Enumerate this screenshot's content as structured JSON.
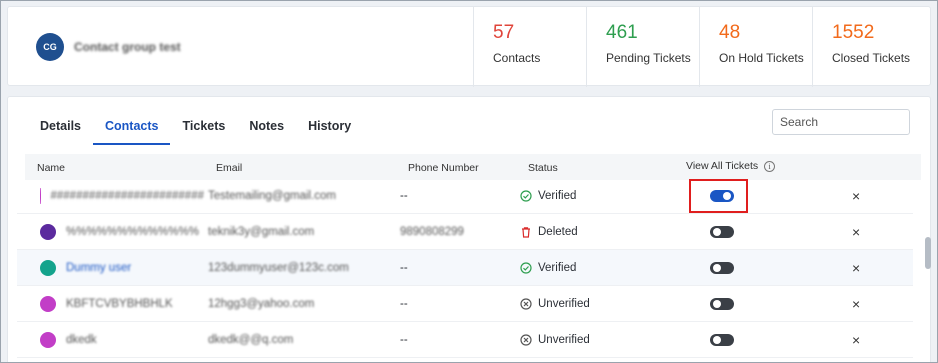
{
  "group": {
    "initials": "CG",
    "name": "Contact group test"
  },
  "stats": [
    {
      "value": "57",
      "label": "Contacts",
      "color": "#e0443a"
    },
    {
      "value": "461",
      "label": "Pending Tickets",
      "color": "#2e9e4f"
    },
    {
      "value": "48",
      "label": "On Hold Tickets",
      "color": "#f26a1b"
    },
    {
      "value": "1552",
      "label": "Closed Tickets",
      "color": "#f26a1b"
    }
  ],
  "tabs": [
    "Details",
    "Contacts",
    "Tickets",
    "Notes",
    "History"
  ],
  "active_tab": "Contacts",
  "search": {
    "placeholder": "Search"
  },
  "table": {
    "headers": {
      "name": "Name",
      "email": "Email",
      "phone": "Phone Number",
      "status": "Status",
      "view_all": "View All Tickets"
    },
    "rows": [
      {
        "name": "########################",
        "email": "Testemailing@gmail.com",
        "phone": "--",
        "status": "Verified",
        "view_all_on": true,
        "avatar_color": "#c23ec7"
      },
      {
        "name": "%%%%%%%%%%%%%",
        "email": "teknik3y@gmail.com",
        "phone": "9890808299",
        "status": "Deleted",
        "view_all_on": false,
        "avatar_color": "#5b2a9e"
      },
      {
        "name": "Dummy user",
        "email": "123dummyuser@123c.com",
        "phone": "--",
        "status": "Verified",
        "view_all_on": false,
        "avatar_color": "#14a38c"
      },
      {
        "name": "KBFTCVBYBHBHLK",
        "email": "12hgg3@yahoo.com",
        "phone": "--",
        "status": "Unverified",
        "view_all_on": false,
        "avatar_color": "#c23ec7"
      },
      {
        "name": "dkedk",
        "email": "dkedk@@q.com",
        "phone": "--",
        "status": "Unverified",
        "view_all_on": false,
        "avatar_color": "#c23ec7"
      }
    ]
  },
  "status_colors": {
    "Verified": "#2e9e4f",
    "Deleted": "#d92a2a",
    "Unverified": "#555555"
  },
  "icons": {
    "close": "×",
    "info": "i"
  }
}
